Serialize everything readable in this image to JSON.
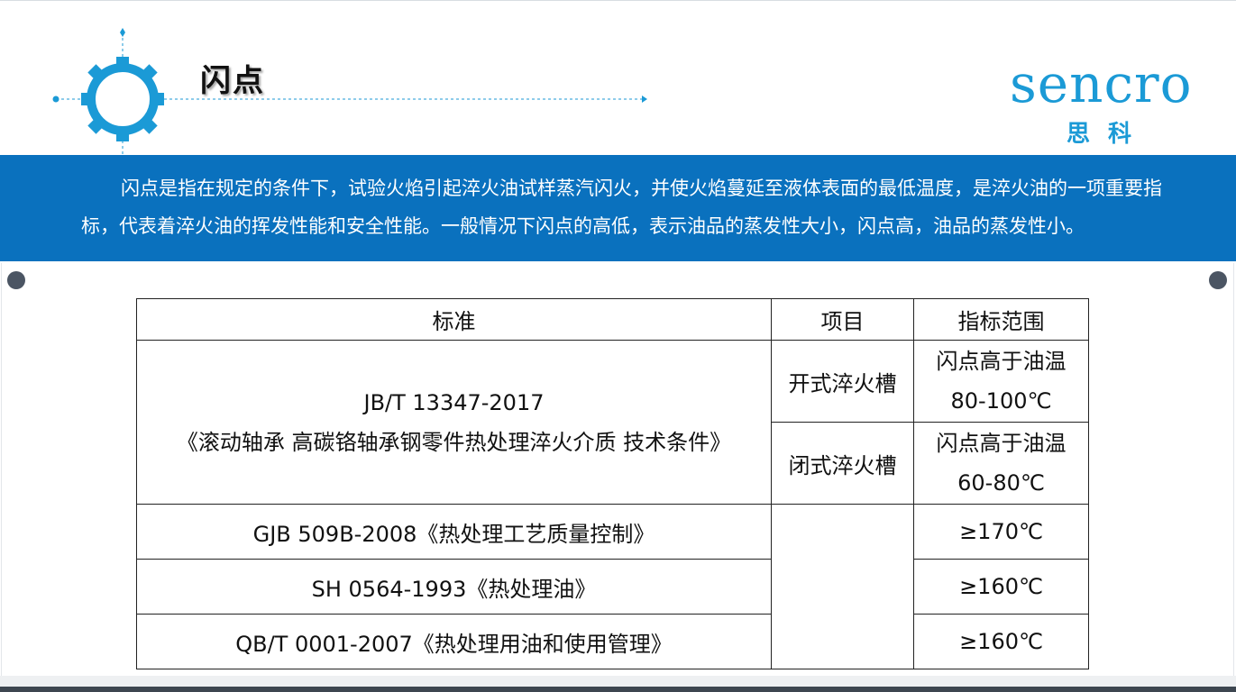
{
  "header": {
    "title": "闪点"
  },
  "logo": {
    "name_en": "sencro",
    "name_cn": "思科",
    "color": "#1b9ad6"
  },
  "intro": {
    "text": "闪点是指在规定的条件下，试验火焰引起淬火油试样蒸汽闪火，并使火焰蔓延至液体表面的最低温度，是淬火油的一项重要指标，代表着淬火油的挥发性能和安全性能。一般情况下闪点的高低，表示油品的蒸发性大小，闪点高，油品的蒸发性小。"
  },
  "table": {
    "headers": [
      "标准",
      "项目",
      "指标范围"
    ],
    "main_standard": {
      "code": "JB/T 13347-2017",
      "title": "《滚动轴承  高碳铬轴承钢零件热处理淬火介质  技术条件》",
      "items": [
        {
          "item": "开式淬火槽",
          "range_label": "闪点高于油温",
          "range_value": "80-100℃"
        },
        {
          "item": "闭式淬火槽",
          "range_label": "闪点高于油温",
          "range_value": "60-80℃"
        }
      ]
    },
    "rows": [
      {
        "standard": "GJB 509B-2008《热处理工艺质量控制》",
        "range": "≥170℃"
      },
      {
        "standard": "SH 0564-1993《热处理油》",
        "range": "≥160℃"
      },
      {
        "standard": "QB/T 0001-2007《热处理用油和使用管理》",
        "range": "≥160℃"
      }
    ]
  },
  "colors": {
    "banner": "#0a71be",
    "accent": "#1b9ad6",
    "dot": "#4b5563"
  }
}
